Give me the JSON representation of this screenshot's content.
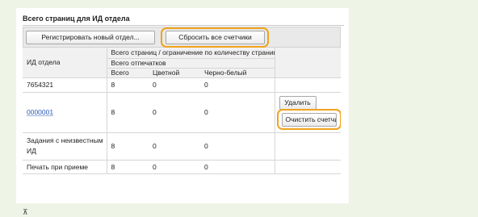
{
  "section_title": "Всего страниц для ИД отдела",
  "toolbar": {
    "register_label": "Регистрировать новый отдел...",
    "reset_all_label": "Сбросить все счетчики"
  },
  "table": {
    "col_id": "ИД отдела",
    "group_header": "Всего страниц / ограничение по количеству страниц",
    "printouts_header": "Всего отпечатков",
    "sub_total": "Всего",
    "sub_color": "Цветной",
    "sub_bw": "Черно-белый",
    "rows": [
      {
        "id": "7654321",
        "total": "8",
        "color": "0",
        "bw": "0"
      },
      {
        "id": "0000001",
        "total": "8",
        "color": "0",
        "bw": "0",
        "delete_label": "Удалить",
        "clear_label": "Очистить счетчик"
      },
      {
        "id": "Задания с неизвестным ИД",
        "total": "8",
        "color": "0",
        "bw": "0"
      },
      {
        "id": "Печать при приеме",
        "total": "8",
        "color": "0",
        "bw": "0"
      }
    ]
  },
  "footer_glyph": "⊼",
  "colors": {
    "highlight": "#f0a31c",
    "link": "#2a57b6",
    "background": "#eef4e6"
  }
}
